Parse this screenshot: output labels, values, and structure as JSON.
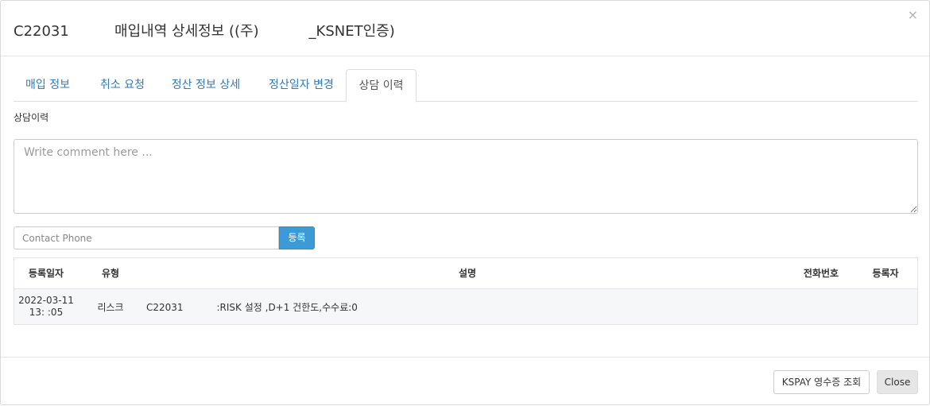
{
  "header": {
    "title": "C22031          매입내역 상세정보 ((주)           _KSNET인증)",
    "close_symbol": "×"
  },
  "tabs": [
    {
      "label": "매입 정보",
      "active": false
    },
    {
      "label": "취소 요청",
      "active": false
    },
    {
      "label": "정산 정보 상세",
      "active": false
    },
    {
      "label": "정산일자 변경",
      "active": false
    },
    {
      "label": "상담 이력",
      "active": true
    }
  ],
  "consult": {
    "section_label": "상담이력",
    "comment_placeholder": "Write comment here ...",
    "phone_placeholder": "Contact Phone",
    "register_label": "등록"
  },
  "table": {
    "headers": {
      "date": "등록일자",
      "type": "유형",
      "desc": "설명",
      "phone": "전화번호",
      "registrant": "등록자"
    },
    "rows": [
      {
        "date_line1": "2022-03-11",
        "date_line2": "13:    :05",
        "type": "리스크",
        "desc": "C22031           :RISK 설정 ,D+1 건한도,수수료:0",
        "phone": "",
        "registrant": ""
      }
    ]
  },
  "footer": {
    "receipt_label": "KSPAY 영수증 조회",
    "close_label": "Close"
  },
  "colors": {
    "accent": "#3c9ad7",
    "tab_link": "#337ab7"
  }
}
